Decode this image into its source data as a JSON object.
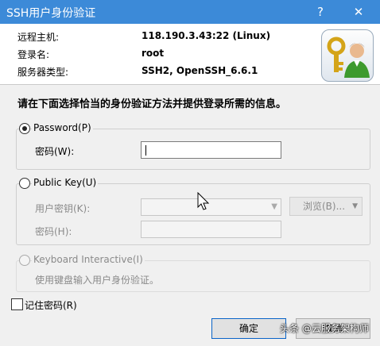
{
  "window": {
    "title": "SSH用户身份验证",
    "help_glyph": "?",
    "close_glyph": "✕"
  },
  "connection": {
    "host_label": "远程主机:",
    "host_value": "118.190.3.43:22 (Linux)",
    "user_label": "登录名:",
    "user_value": "root",
    "server_type_label": "服务器类型:",
    "server_type_value": "SSH2, OpenSSH_6.6.1"
  },
  "instruction": "请在下面选择恰当的身份验证方法并提供登录所需的信息。",
  "password_method": {
    "label": "Password(P)",
    "selected": true,
    "password_label": "密码(W):",
    "password_value": ""
  },
  "publickey_method": {
    "label": "Public Key(U)",
    "selected": false,
    "user_key_label": "用户密钥(K):",
    "user_key_value": "",
    "browse_label": "浏览(B)...",
    "passphrase_label": "密码(H):"
  },
  "keyboard_method": {
    "label": "Keyboard Interactive(I)",
    "description": "使用键盘输入用户身份验证。"
  },
  "remember_password": {
    "label": "记住密码(R)",
    "checked": false
  },
  "buttons": {
    "ok": "确定",
    "cancel": "取消"
  },
  "watermark": "头条 @云服务架构师",
  "icons": [
    "help-icon",
    "close-icon",
    "key-user-icon",
    "dropdown-arrow-icon",
    "mouse-cursor-icon"
  ]
}
